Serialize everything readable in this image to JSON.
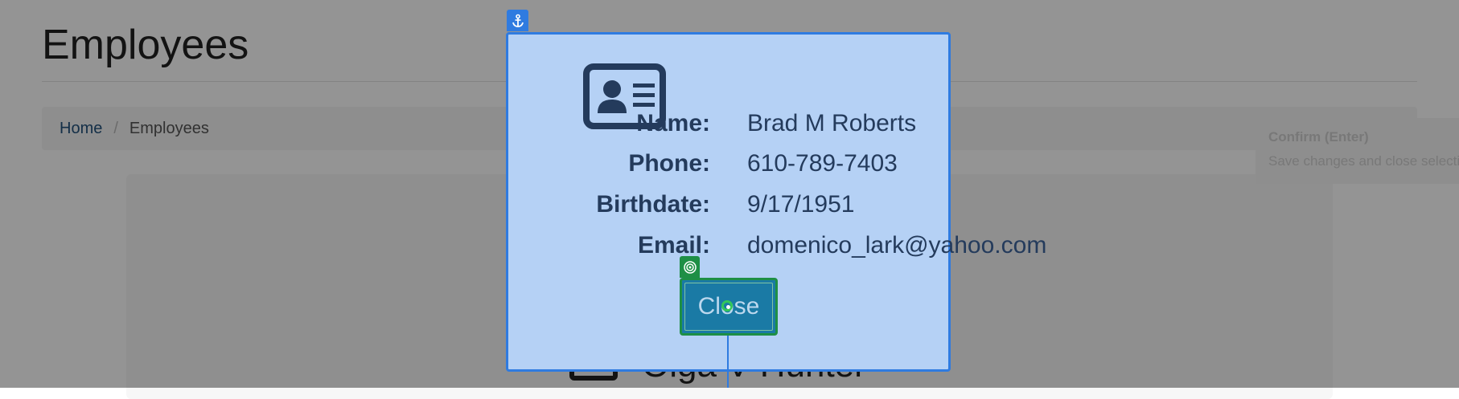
{
  "page": {
    "title": "Employees",
    "breadcrumb": {
      "home": "Home",
      "separator": "/",
      "current": "Employees"
    },
    "background_employee_name": "Olga V Hunter"
  },
  "hint": {
    "title": "Confirm (Enter)",
    "text": "Save changes and close selection"
  },
  "dialog": {
    "icon": "id-card-icon",
    "fields": {
      "name_label": "Name:",
      "name_value": "Brad M Roberts",
      "phone_label": "Phone:",
      "phone_value": "610-789-7403",
      "birthdate_label": "Birthdate:",
      "birthdate_value": "9/17/1951",
      "email_label": "Email:",
      "email_value": "domenico_lark@yahoo.com"
    },
    "close_label": "Close"
  },
  "annotations": {
    "anchor_icon": "anchor-icon",
    "target_icon": "target-icon",
    "colors": {
      "anchor": "#2f7be0",
      "target": "#1e8f45",
      "dialog_bg": "#b5d1f5"
    }
  }
}
